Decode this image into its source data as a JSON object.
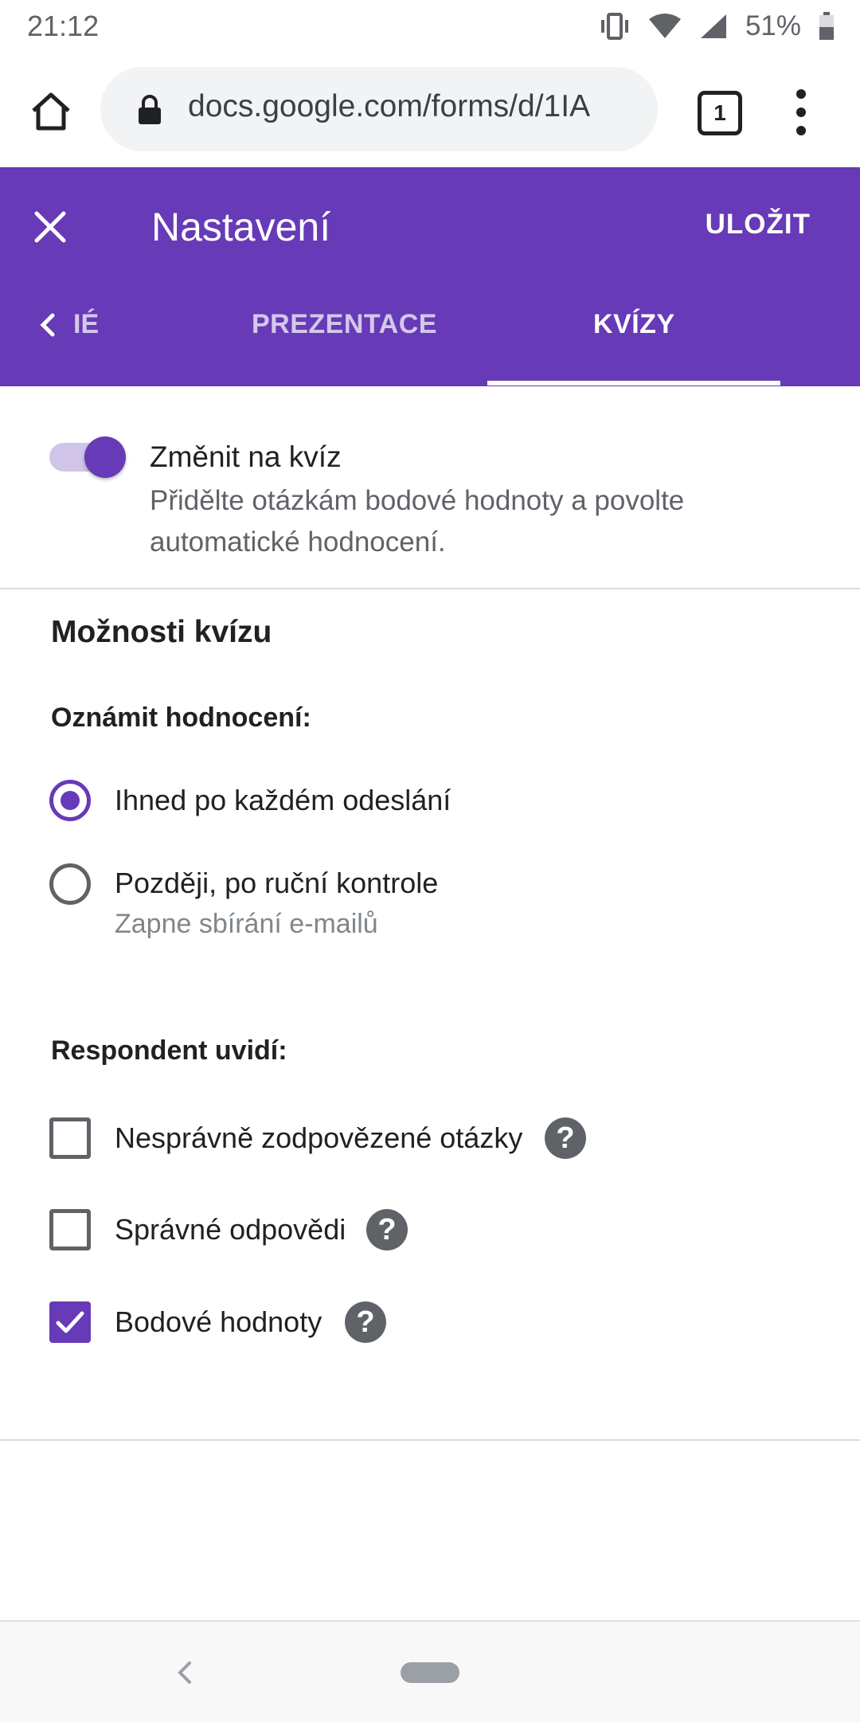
{
  "status_bar": {
    "time": "21:12",
    "battery_pct": "51%"
  },
  "browser": {
    "url": "docs.google.com/forms/d/1IA",
    "tab_count": "1"
  },
  "header": {
    "title": "Nastavení",
    "save_label": "ULOŽIT",
    "tabs": [
      {
        "label": "IÉ"
      },
      {
        "label": "PREZENTACE"
      },
      {
        "label": "KVÍZY"
      }
    ],
    "active_tab": "KVÍZY",
    "accent_color": "#673ab7"
  },
  "quiz_toggle": {
    "title": "Změnit na kvíz",
    "description": "Přidělte otázkám bodové hodnoty a povolte automatické hodnocení.",
    "enabled": true
  },
  "quiz_options": {
    "section_title": "Možnosti kvízu",
    "release_grade": {
      "label": "Oznámit hodnocení:",
      "options": [
        {
          "label": "Ihned po každém odeslání",
          "selected": true
        },
        {
          "label": "Později, po ruční kontrole",
          "sublabel": "Zapne sbírání e-mailů",
          "selected": false
        }
      ]
    },
    "respondent_sees": {
      "label": "Respondent uvidí:",
      "items": [
        {
          "label": "Nesprávně zodpovězené otázky",
          "checked": false,
          "icon": "help-icon"
        },
        {
          "label": "Správné odpovědi",
          "checked": false,
          "icon": "help-icon"
        },
        {
          "label": "Bodové hodnoty",
          "checked": true,
          "icon": "help-icon"
        }
      ]
    }
  }
}
